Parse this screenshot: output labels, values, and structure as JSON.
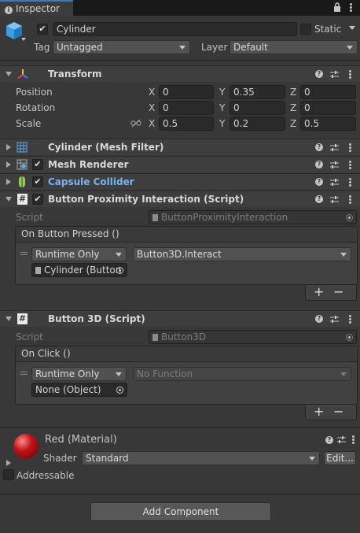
{
  "tab": {
    "label": "Inspector"
  },
  "gameobject": {
    "name": "Cylinder",
    "static_label": "Static",
    "tag_label": "Tag",
    "tag_value": "Untagged",
    "layer_label": "Layer",
    "layer_value": "Default"
  },
  "transform": {
    "title": "Transform",
    "rows": [
      {
        "label": "Position",
        "x": "0",
        "y": "0.35",
        "z": "0"
      },
      {
        "label": "Rotation",
        "x": "0",
        "y": "0",
        "z": "0"
      },
      {
        "label": "Scale",
        "x": "0.5",
        "y": "0.2",
        "z": "0.5"
      }
    ],
    "axis_x": "X",
    "axis_y": "Y",
    "axis_z": "Z"
  },
  "components": {
    "mesh_filter": "Cylinder (Mesh Filter)",
    "mesh_renderer": "Mesh Renderer",
    "capsule_collider": "Capsule Collider",
    "button_proximity": "Button Proximity Interaction (Script)",
    "button3d": "Button 3D (Script)"
  },
  "proximity": {
    "script_label": "Script",
    "script_value": "ButtonProximityInteraction",
    "event_title": "On Button Pressed ()",
    "runtime": "Runtime Only",
    "function": "Button3D.Interact",
    "target": "Cylinder (Button"
  },
  "button3d": {
    "script_label": "Script",
    "script_value": "Button3D",
    "event_title": "On Click ()",
    "runtime": "Runtime Only",
    "function": "No Function",
    "target": "None (Object)"
  },
  "material": {
    "title": "Red (Material)",
    "shader_label": "Shader",
    "shader_value": "Standard",
    "edit_label": "Edit...",
    "color": "#c0121a"
  },
  "addressable": {
    "label": "Addressable"
  },
  "add_component": {
    "label": "Add Component"
  },
  "plus_minus": {
    "plus": "+",
    "minus": "−"
  }
}
